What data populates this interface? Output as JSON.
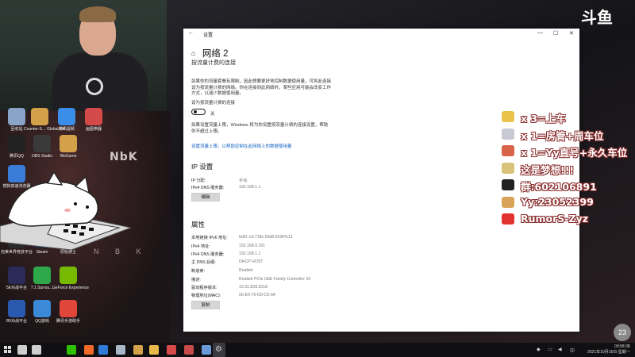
{
  "window": {
    "app_title": "设置",
    "page_title": "网络 2",
    "subheading": "按流量计费的连接",
    "metered_intro": [
      "如果你的流量套餐有限制，因此想要更好地控制数据使用量，可将此连接",
      "设为按流量计费的网络。你在连接到此网络时，某些应用可能会改变工作",
      "方式，以减少数据使用量。"
    ],
    "metered_toggle_label": "设为按流量计费的连接",
    "metered_toggle_state": "关",
    "data_limit_note": [
      "如果设置流量上限，Windows 将为你设置按流量计费的连接设置，帮助",
      "你不超过上限。"
    ],
    "data_limit_link": "设置流量上限，以帮助控制在此网络上的数据使用量",
    "ip_section": {
      "heading": "IP 设置",
      "rows": [
        {
          "key": "IP 分配:",
          "value": "手动"
        },
        {
          "key": "IPv4 DNS 服务器:",
          "value": "192.168.1.1"
        }
      ],
      "edit_button": "编辑"
    },
    "properties": {
      "heading": "属性",
      "rows": [
        {
          "key": "本地链接 IPv6 地址:",
          "value": "fe80::c0:718c:53d8:9236%13"
        },
        {
          "key": "IPv4 地址:",
          "value": "192.168.0.101"
        },
        {
          "key": "IPv4 DNS 服务器:",
          "value": "192.168.1.1"
        },
        {
          "key": "主 DNS 后缀:",
          "value": "DHCP HOST"
        },
        {
          "key": "制造商:",
          "value": "Realtek"
        },
        {
          "key": "描述:",
          "value": "Realtek PCIe GbE Family Controller #2"
        },
        {
          "key": "驱动程序版本:",
          "value": "10.31.828.2018"
        },
        {
          "key": "物理地址(MAC):",
          "value": "00-E0-70-D0-C0-0A"
        }
      ],
      "copy_button": "复制"
    }
  },
  "overlay": [
    {
      "text": "x 3=上车",
      "icon": "gold-bar-icon",
      "color": "#e8c24a"
    },
    {
      "text": "x 1=房管+周车位",
      "icon": "airplane-icon",
      "color": "#c9c9d6"
    },
    {
      "text": "x 1=Yy直号+永久车位",
      "icon": "rocket-icon",
      "color": "#d8644a"
    },
    {
      "text": "这是梦想!!!",
      "icon": "mascot-icon",
      "color": "#d9c27a"
    },
    {
      "text": "群:602106891",
      "icon": "qq-penguin-icon",
      "color": "#222222"
    },
    {
      "text": "Yy:23052399",
      "icon": "yy-bear-icon",
      "color": "#d8a45a"
    },
    {
      "text": "RumorS-Zyz",
      "icon": "weibo-icon",
      "color": "#e2322f"
    }
  ],
  "watermark": "斗鱼",
  "badge": "23",
  "desktop_icons": [
    {
      "label": "回收站",
      "icon": "recycle-bin-icon",
      "color": "#8aa4c8"
    },
    {
      "label": "Counter-S… Global Off…",
      "icon": "csgo-icon",
      "color": "#d4a14a"
    },
    {
      "label": "腾讯视频",
      "icon": "tencent-video-icon",
      "color": "#3b8ee8"
    },
    {
      "label": "画图带器",
      "icon": "paint-icon",
      "color": "#d44a4a"
    },
    {
      "label": "腾讯QQ",
      "icon": "qq-icon",
      "color": "#222222"
    },
    {
      "label": "OBS Studio",
      "icon": "obs-icon",
      "color": "#3a3a3a"
    },
    {
      "label": "WeGame",
      "icon": "wegame-icon",
      "color": "#d4a04a"
    },
    {
      "label": "搜狗高速浏览器",
      "icon": "sogou-browser-icon",
      "color": "#3b7bd8"
    },
    {
      "label": "完美世界竞技平台",
      "icon": "perfect-world-icon",
      "color": "#2a2a2a"
    },
    {
      "label": "Steam",
      "icon": "steam-icon",
      "color": "#1b2838"
    },
    {
      "label": "原始骑士",
      "icon": "game-icon",
      "color": "#4a6a3a"
    },
    {
      "label": "5E对战平台",
      "icon": "5e-icon",
      "color": "#2b2b5a"
    },
    {
      "label": "7.1 Surrou…",
      "icon": "surround-icon",
      "color": "#2ea84a"
    },
    {
      "label": "GeForce Experience",
      "icon": "geforce-icon",
      "color": "#76b900"
    },
    {
      "label": "B5对战平台",
      "icon": "b5-icon",
      "color": "#2a5ab0"
    },
    {
      "label": "QQ游戏",
      "icon": "qq-game-icon",
      "color": "#3a8ad8"
    },
    {
      "label": "腾讯手游助手",
      "icon": "tencent-mobile-icon",
      "color": "#e0463a"
    }
  ],
  "desktop_bg_text": {
    "logo": "NbK",
    "sub": "N B K"
  },
  "taskbar": {
    "clock_time": "09:58:38",
    "clock_date": "2021年10月16日 星期一",
    "tray_lang": "中",
    "items": [
      {
        "icon": "search-icon",
        "color": "#cfcfcf"
      },
      {
        "icon": "task-view-icon",
        "color": "#cfcfcf"
      },
      {
        "icon": "wechat-icon",
        "color": "#2dc100"
      },
      {
        "icon": "douyu-icon",
        "color": "#f26a2a"
      },
      {
        "icon": "edge-icon",
        "color": "#2f7bd8"
      },
      {
        "icon": "steam-icon",
        "color": "#a9b8c8"
      },
      {
        "icon": "csgo-icon",
        "color": "#d4a14a"
      },
      {
        "icon": "file-explorer-icon",
        "color": "#e8b84a"
      },
      {
        "icon": "video-icon",
        "color": "#d84a4a"
      },
      {
        "icon": "game-icon",
        "color": "#c84a4a"
      },
      {
        "icon": "steam-icon",
        "color": "#6a9ad8"
      },
      {
        "icon": "settings-icon",
        "color": "#cfcfcf"
      }
    ]
  }
}
